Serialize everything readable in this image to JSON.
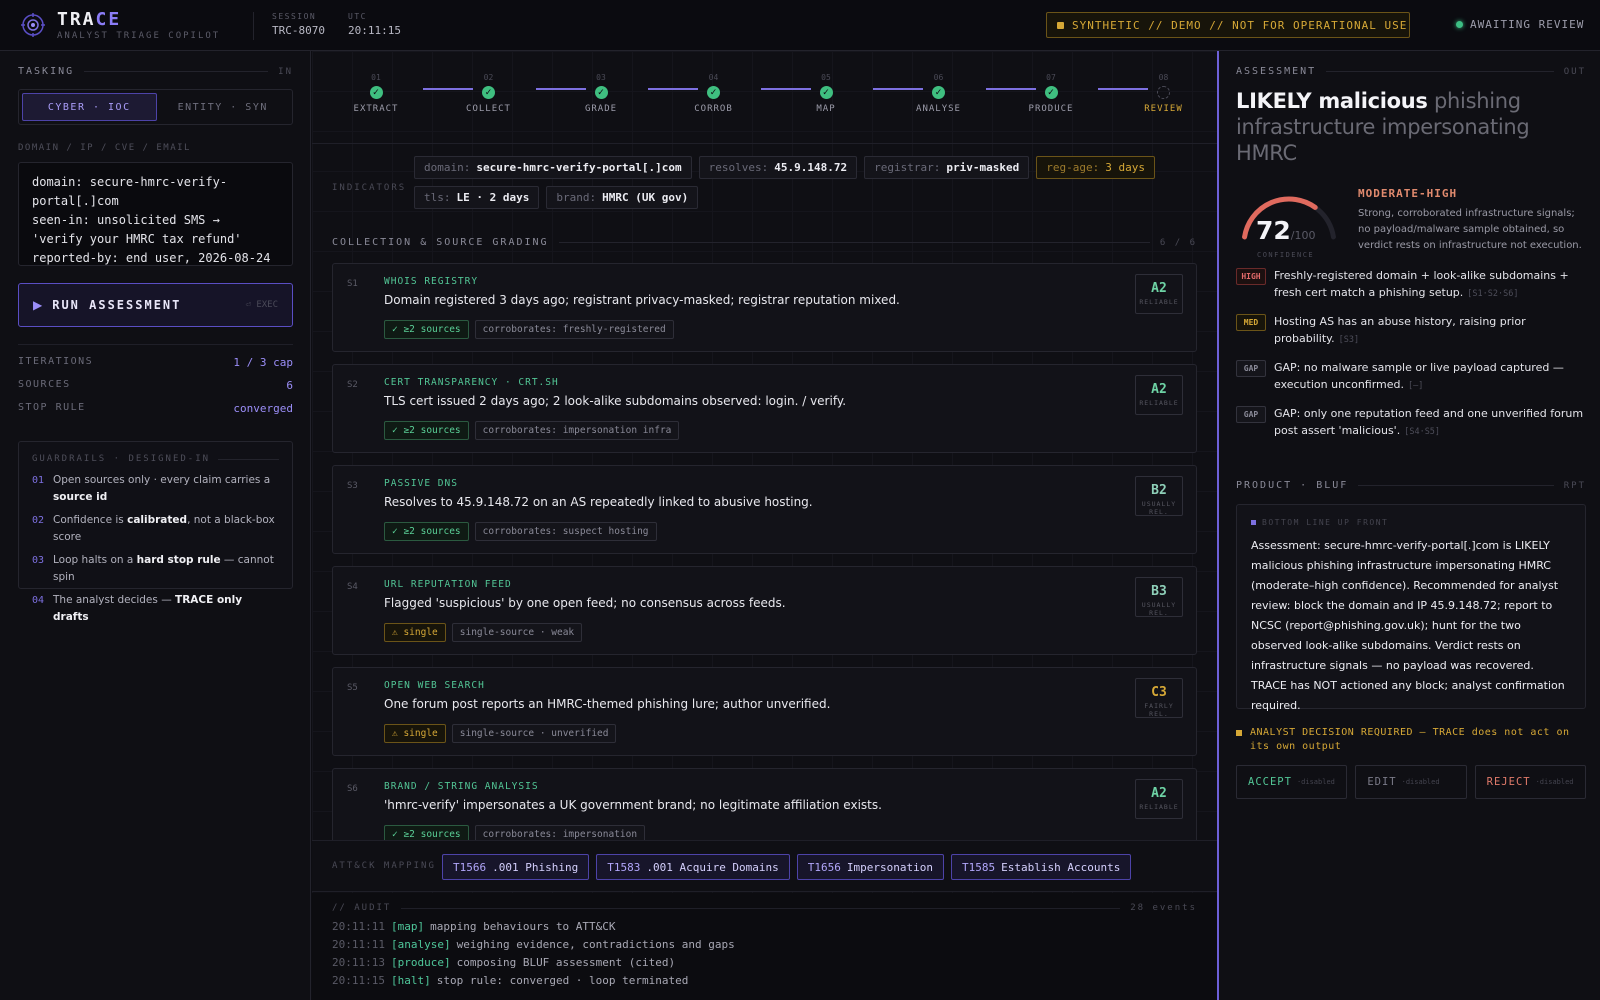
{
  "topbar": {
    "brand_a": "TRA",
    "brand_b": "CE",
    "tagline": "ANALYST TRIAGE COPILOT",
    "session_label": "SESSION",
    "session_value": "TRC-8070",
    "utc_label": "UTC",
    "utc_value": "20:11:15",
    "banner": "SYNTHETIC // DEMO // NOT FOR OPERATIONAL USE",
    "status": "AWAITING REVIEW"
  },
  "tasking": {
    "title": "TASKING",
    "tag": "IN",
    "modes": [
      "CYBER · IOC",
      "ENTITY · SYN"
    ],
    "field_label": "DOMAIN / IP / CVE / EMAIL",
    "input_value": "domain: secure-hmrc-verify-portal[.]com\nseen-in: unsolicited SMS →\n'verify your HMRC tax refund'\nreported-by: end user, 2026-08-24",
    "run_label": "RUN ASSESSMENT",
    "run_hint": "⏎ EXEC",
    "iterations_label": "ITERATIONS",
    "iterations_value": "1 / 3 cap",
    "sources_label": "SOURCES",
    "sources_value": "6",
    "stop_label": "STOP RULE",
    "stop_value": "converged",
    "guard_title": "GUARDRAILS · DESIGNED-IN",
    "guards": [
      {
        "n": "01",
        "pre": "Open sources only · every claim carries a ",
        "b": "source id",
        "post": ""
      },
      {
        "n": "02",
        "pre": "Confidence is ",
        "b": "calibrated",
        "post": ", not a black-box score"
      },
      {
        "n": "03",
        "pre": "Loop halts on a ",
        "b": "hard stop rule",
        "post": " — cannot spin"
      },
      {
        "n": "04",
        "pre": "The analyst decides — ",
        "b": "TRACE only drafts",
        "post": ""
      }
    ]
  },
  "steps": [
    {
      "num": "01",
      "name": "EXTRACT",
      "done": true
    },
    {
      "num": "02",
      "name": "COLLECT",
      "done": true
    },
    {
      "num": "03",
      "name": "GRADE",
      "done": true
    },
    {
      "num": "04",
      "name": "CORROB",
      "done": true
    },
    {
      "num": "05",
      "name": "MAP",
      "done": true
    },
    {
      "num": "06",
      "name": "ANALYSE",
      "done": true
    },
    {
      "num": "07",
      "name": "PRODUCE",
      "done": true
    },
    {
      "num": "08",
      "name": "REVIEW",
      "done": false
    }
  ],
  "indicators": {
    "label": "INDICATORS",
    "chips": [
      {
        "k": "domain:",
        "v": "secure-hmrc-verify-portal[.]com",
        "warn": false
      },
      {
        "k": "resolves:",
        "v": "45.9.148.72",
        "warn": false
      },
      {
        "k": "registrar:",
        "v": "priv-masked",
        "warn": false
      },
      {
        "k": "reg-age:",
        "v": "3 days",
        "warn": true
      },
      {
        "k": "tls:",
        "v": "LE · 2 days",
        "warn": false
      },
      {
        "k": "brand:",
        "v": "HMRC (UK gov)",
        "warn": false
      }
    ]
  },
  "collection": {
    "title": "COLLECTION & SOURCE GRADING",
    "count": "6 / 6",
    "sources": [
      {
        "id": "S1",
        "title": "WHOIS REGISTRY",
        "desc": "Domain registered 3 days ago; registrant privacy-masked; registrar reputation mixed.",
        "tag1": "✓ ≥2 sources",
        "tag1_type": "ok",
        "tag2": "corroborates: freshly-registered",
        "grade": "A2",
        "grade_label": "RELIABLE",
        "grade_color": "#6ed3a5"
      },
      {
        "id": "S2",
        "title": "CERT TRANSPARENCY · CRT.SH",
        "desc": "TLS cert issued 2 days ago; 2 look-alike subdomains observed: login. / verify.",
        "tag1": "✓ ≥2 sources",
        "tag1_type": "ok",
        "tag2": "corroborates: impersonation infra",
        "grade": "A2",
        "grade_label": "RELIABLE",
        "grade_color": "#6ed3a5"
      },
      {
        "id": "S3",
        "title": "PASSIVE DNS",
        "desc": "Resolves to 45.9.148.72 on an AS repeatedly linked to abusive hosting.",
        "tag1": "✓ ≥2 sources",
        "tag1_type": "ok",
        "tag2": "corroborates: suspect hosting",
        "grade": "B2",
        "grade_label": "USUALLY REL.",
        "grade_color": "#8ecfb8"
      },
      {
        "id": "S4",
        "title": "URL REPUTATION FEED",
        "desc": "Flagged 'suspicious' by one open feed; no consensus across feeds.",
        "tag1": "⚠ single",
        "tag1_type": "single",
        "tag2": "single-source · weak",
        "grade": "B3",
        "grade_label": "USUALLY REL.",
        "grade_color": "#8ecfb8"
      },
      {
        "id": "S5",
        "title": "OPEN WEB SEARCH",
        "desc": "One forum post reports an HMRC-themed phishing lure; author unverified.",
        "tag1": "⚠ single",
        "tag1_type": "single",
        "tag2": "single-source · unverified",
        "grade": "C3",
        "grade_label": "FAIRLY REL.",
        "grade_color": "#d6a836"
      },
      {
        "id": "S6",
        "title": "BRAND / STRING ANALYSIS",
        "desc": "'hmrc-verify' impersonates a UK government brand; no legitimate affiliation exists.",
        "tag1": "✓ ≥2 sources",
        "tag1_type": "ok",
        "tag2": "corroborates: impersonation",
        "grade": "A2",
        "grade_label": "RELIABLE",
        "grade_color": "#6ed3a5"
      }
    ]
  },
  "attack": {
    "label": "ATT&CK MAPPING",
    "ttps": [
      {
        "id": "T1566",
        "name": ".001 Phishing"
      },
      {
        "id": "T1583",
        "name": ".001 Acquire Domains"
      },
      {
        "id": "T1656",
        "name": "Impersonation"
      },
      {
        "id": "T1585",
        "name": "Establish Accounts"
      }
    ]
  },
  "audit": {
    "title": "// AUDIT",
    "count": "28 events",
    "lines": [
      {
        "ts": "20:11:11",
        "phase": "[map]",
        "msg": "mapping behaviours to ATT&CK"
      },
      {
        "ts": "20:11:11",
        "phase": "[analyse]",
        "msg": "weighing evidence, contradictions and gaps"
      },
      {
        "ts": "20:11:13",
        "phase": "[produce]",
        "msg": "composing BLUF assessment (cited)"
      },
      {
        "ts": "20:11:15",
        "phase": "[halt]",
        "msg": "stop rule: converged · loop terminated"
      }
    ]
  },
  "assessment": {
    "title": "ASSESSMENT",
    "tag": "OUT",
    "verdict_bold": "LIKELY malicious",
    "verdict_rest": " phishing infrastructure impersonating HMRC",
    "confidence_value": "72",
    "confidence_max": "/100",
    "confidence_fraction": 0.72,
    "confidence_label": "CONFIDENCE",
    "confidence_level": "MODERATE-HIGH",
    "confidence_text": "Strong, corroborated infrastructure signals; no payload/malware sample obtained, so verdict rests on infrastructure not execution.",
    "findings": [
      {
        "badge": "HIGH",
        "type": "high",
        "text": "Freshly-registered domain + look-alike subdomains + fresh cert match a phishing setup.",
        "ref": "[S1·S2·S6]"
      },
      {
        "badge": "MED",
        "type": "med",
        "text": "Hosting AS has an abuse history, raising prior probability.",
        "ref": "[S3]"
      },
      {
        "badge": "GAP",
        "type": "gap",
        "text": "GAP: no malware sample or live payload captured — execution unconfirmed.",
        "ref": "[—]"
      },
      {
        "badge": "GAP",
        "type": "gap",
        "text": "GAP: only one reputation feed and one unverified forum post assert 'malicious'.",
        "ref": "[S4·S5]"
      }
    ]
  },
  "product": {
    "title": "PRODUCT · BLUF",
    "tag": "RPT",
    "bluf_label": "BOTTOM LINE UP FRONT",
    "bluf_text": "Assessment: secure-hmrc-verify-portal[.]com is LIKELY malicious phishing infrastructure impersonating HMRC (moderate–high confidence). Recommended for analyst review: block the domain and IP 45.9.148.72; report to NCSC (report@phishing.gov.uk); hunt for the two observed look-alike subdomains. Verdict rests on infrastructure signals — no payload was recovered. TRACE has NOT actioned any block; analyst confirmation required.",
    "decision": "ANALYST DECISION REQUIRED — TRACE does not act on its own output",
    "accept": "ACCEPT",
    "edit": "EDIT",
    "reject": "REJECT",
    "disabled": "·disabled"
  },
  "colors": {
    "accent": "#7d70e0",
    "ok": "#3fbf80",
    "warn": "#d6a836",
    "danger": "#e26a6a"
  }
}
